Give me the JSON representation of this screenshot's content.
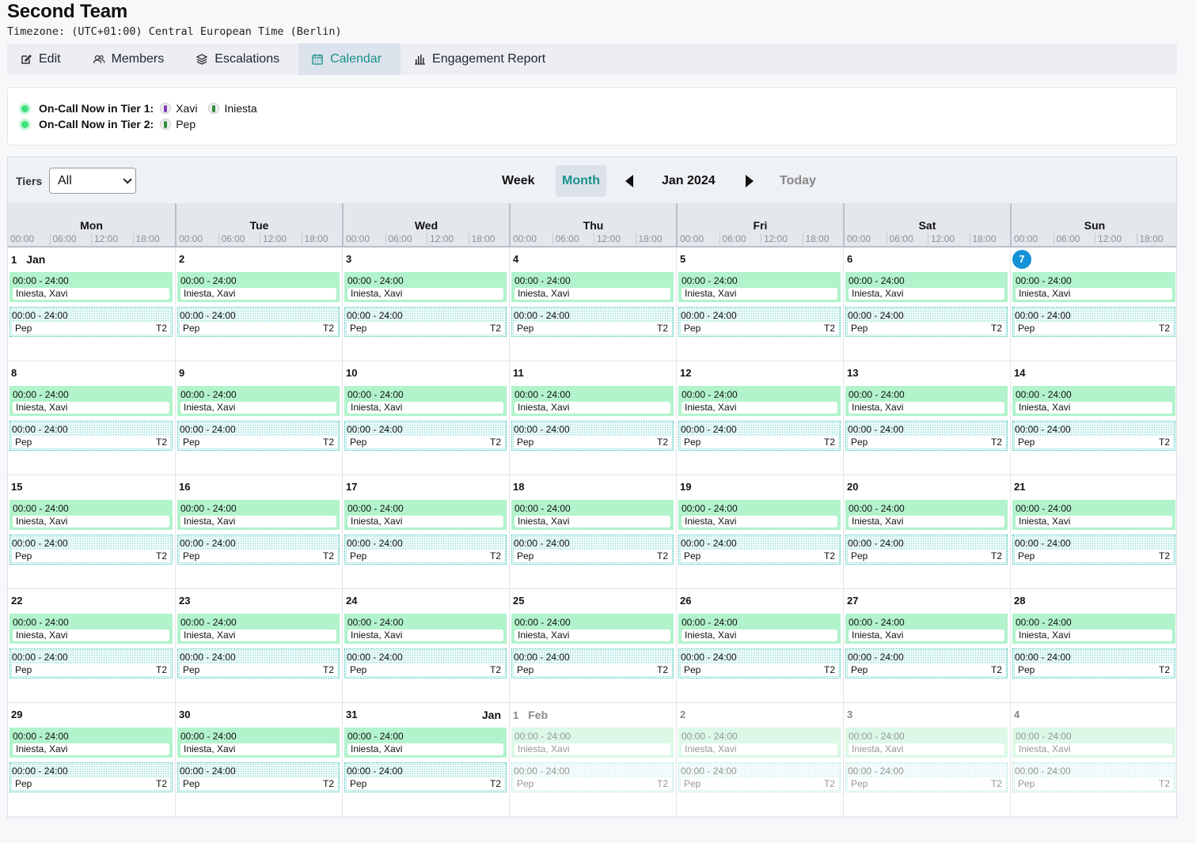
{
  "team": {
    "title": "Second Team",
    "timezone": "Timezone: (UTC+01:00) Central European Time (Berlin)"
  },
  "tabs": [
    {
      "label": "Edit",
      "icon": "edit-icon",
      "active": false
    },
    {
      "label": "Members",
      "icon": "members-icon",
      "active": false
    },
    {
      "label": "Escalations",
      "icon": "layers-icon",
      "active": false
    },
    {
      "label": "Calendar",
      "icon": "calendar-icon",
      "active": true
    },
    {
      "label": "Engagement Report",
      "icon": "bar-chart-icon",
      "active": false
    }
  ],
  "oncall": {
    "tier1_label": "On-Call Now in Tier 1:",
    "tier1_people": [
      "Xavi",
      "Iniesta"
    ],
    "tier2_label": "On-Call Now in Tier 2:",
    "tier2_people": [
      "Pep"
    ]
  },
  "toolbar": {
    "tiers_label": "Tiers",
    "tiers_value": "All",
    "week_label": "Week",
    "month_label": "Month",
    "period": "Jan 2024",
    "today_label": "Today"
  },
  "header": {
    "days": [
      "Mon",
      "Tue",
      "Wed",
      "Thu",
      "Fri",
      "Sat",
      "Sun"
    ],
    "ticks": [
      "00:00",
      "06:00",
      "12:00",
      "18:00"
    ]
  },
  "events": {
    "tier1_time": "00:00 - 24:00",
    "tier1_people": "Iniesta, Xavi",
    "tier2_time": "00:00 - 24:00",
    "tier2_people": "Pep",
    "tier2_badge": "T2"
  },
  "month_labels": {
    "jan": "Jan",
    "feb": "Feb"
  },
  "weeks": [
    [
      {
        "d": "1",
        "mon": "Jan"
      },
      {
        "d": "2"
      },
      {
        "d": "3"
      },
      {
        "d": "4"
      },
      {
        "d": "5"
      },
      {
        "d": "6"
      },
      {
        "d": "7",
        "today": true
      }
    ],
    [
      {
        "d": "8"
      },
      {
        "d": "9"
      },
      {
        "d": "10"
      },
      {
        "d": "11"
      },
      {
        "d": "12"
      },
      {
        "d": "13"
      },
      {
        "d": "14"
      }
    ],
    [
      {
        "d": "15"
      },
      {
        "d": "16"
      },
      {
        "d": "17"
      },
      {
        "d": "18"
      },
      {
        "d": "19"
      },
      {
        "d": "20"
      },
      {
        "d": "21"
      }
    ],
    [
      {
        "d": "22"
      },
      {
        "d": "23"
      },
      {
        "d": "24"
      },
      {
        "d": "25"
      },
      {
        "d": "26"
      },
      {
        "d": "27"
      },
      {
        "d": "28"
      }
    ],
    [
      {
        "d": "29"
      },
      {
        "d": "30"
      },
      {
        "d": "31",
        "end": "Jan"
      },
      {
        "d": "1",
        "mon": "Feb",
        "other": true
      },
      {
        "d": "2",
        "other": true
      },
      {
        "d": "3",
        "other": true
      },
      {
        "d": "4",
        "other": true
      }
    ]
  ],
  "colors": {
    "accent": "#17918a",
    "tier1": "#b2f3cc",
    "tier2": "#3cbfb3",
    "today": "#1492d8",
    "dot": "#3ee27f"
  }
}
